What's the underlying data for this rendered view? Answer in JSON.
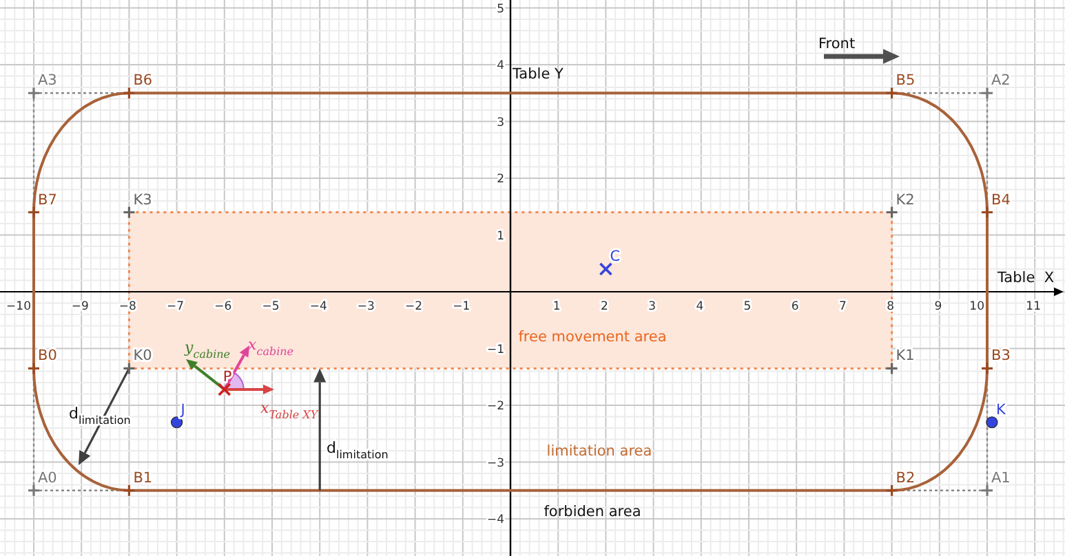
{
  "graph": {
    "axes": {
      "x_label": "Table  X",
      "y_label": "Table Y",
      "x_ticks": [
        "−10",
        "−9",
        "−8",
        "−7",
        "−6",
        "−5",
        "−4",
        "−3",
        "−2",
        "−1",
        "1",
        "2",
        "3",
        "4",
        "5",
        "6",
        "7",
        "8",
        "9",
        "10",
        "11"
      ],
      "y_ticks": [
        "5",
        "4",
        "3",
        "2",
        "1",
        "−1",
        "−2",
        "−3",
        "−4"
      ]
    },
    "points": [
      {
        "label": "A3",
        "kind": "corner"
      },
      {
        "label": "B6",
        "kind": "boundary"
      },
      {
        "label": "B5",
        "kind": "boundary"
      },
      {
        "label": "A2",
        "kind": "corner"
      },
      {
        "label": "B7",
        "kind": "boundary"
      },
      {
        "label": "K3",
        "kind": "inner"
      },
      {
        "label": "K2",
        "kind": "inner"
      },
      {
        "label": "B4",
        "kind": "boundary"
      },
      {
        "label": "C",
        "kind": "cross"
      },
      {
        "label": "B0",
        "kind": "boundary"
      },
      {
        "label": "K0",
        "kind": "inner"
      },
      {
        "label": "K1",
        "kind": "inner"
      },
      {
        "label": "B3",
        "kind": "boundary"
      },
      {
        "label": "P",
        "kind": "pose"
      },
      {
        "label": "J",
        "kind": "target"
      },
      {
        "label": "K",
        "kind": "target"
      },
      {
        "label": "A0",
        "kind": "corner"
      },
      {
        "label": "B1",
        "kind": "boundary"
      },
      {
        "label": "B2",
        "kind": "boundary"
      },
      {
        "label": "A1",
        "kind": "corner"
      }
    ],
    "areas": [
      {
        "label": "free movement area",
        "kind": "free"
      },
      {
        "label": "limitation area",
        "kind": "limitation"
      },
      {
        "label": "forbiden area",
        "kind": "forbidden"
      }
    ],
    "distances": [
      {
        "symbol": "d",
        "subscript": "limitation"
      },
      {
        "symbol": "d",
        "subscript": "limitation"
      }
    ],
    "pose_vectors": [
      {
        "symbol": "y",
        "subscript": "cabine",
        "kind": "y_cabine"
      },
      {
        "symbol": "x",
        "subscript": "cabine",
        "kind": "x_cabine"
      },
      {
        "symbol": "x",
        "subscript": "Table XY",
        "kind": "x_table"
      }
    ],
    "direction": {
      "label": "Front"
    }
  }
}
